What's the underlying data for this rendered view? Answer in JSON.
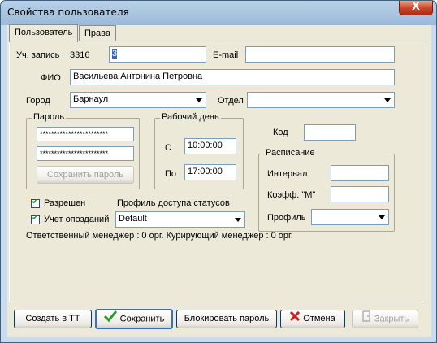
{
  "window": {
    "title": "Свойства пользователя",
    "close_label": "X"
  },
  "tabs": [
    {
      "label": "Пользователь"
    },
    {
      "label": "Права"
    }
  ],
  "account": {
    "label": "Уч. запись",
    "number": "3316",
    "value": "3"
  },
  "email": {
    "label": "E-mail",
    "value": ""
  },
  "fio": {
    "label": "ФИО",
    "value": "Васильева Антонина Петровна"
  },
  "city": {
    "label": "Город",
    "value": "Барнаул"
  },
  "department": {
    "label": "Отдел",
    "value": ""
  },
  "password": {
    "group_title": "Пароль",
    "field1": "************************",
    "field2": "************************",
    "save_label": "Сохранить пароль"
  },
  "workday": {
    "group_title": "Рабочий день",
    "from_label": "С",
    "from_value": "10:00:00",
    "to_label": "По",
    "to_value": "17:00:00"
  },
  "code": {
    "label": "Код",
    "value": ""
  },
  "schedule": {
    "group_title": "Расписание",
    "interval_label": "Интервал",
    "interval_value": "",
    "coef_label": "Коэфф. \"М\"",
    "coef_value": "",
    "profile_label": "Профиль",
    "profile_value": ""
  },
  "allowed": {
    "label": "Разрешен",
    "checked": true
  },
  "lateness": {
    "label": "Учет опозданий",
    "checked": true
  },
  "status_profile": {
    "label": "Профиль доступа статусов",
    "value": "Default"
  },
  "managers_text": "Ответственный менеджер : 0 орг. Курирующий менеджер : 0 орг.",
  "buttons": {
    "create_tt": "Создать в ТТ",
    "save": "Сохранить",
    "block_password": "Блокировать пароль",
    "cancel": "Отмена",
    "close": "Закрыть"
  },
  "colors": {
    "save_icon": "#2e9a2e",
    "cancel_icon": "#c81e1e",
    "title_close": "#c84a2c"
  }
}
